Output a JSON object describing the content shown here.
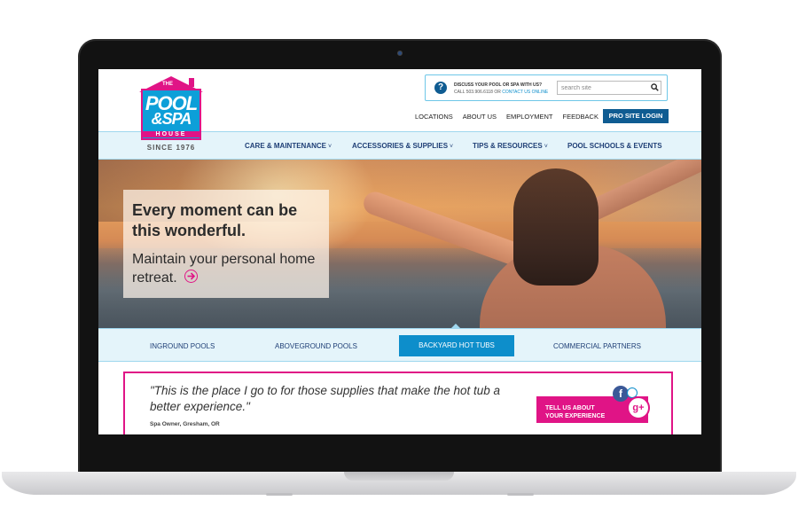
{
  "logo": {
    "the": "THE",
    "pool": "POOL",
    "spa": "&SPA",
    "house": "HOUSE",
    "since": "SINCE 1976"
  },
  "contact": {
    "question": "DISCUSS YOUR POOL OR SPA WITH US?",
    "call_text": "CALL 503.906.6118 OR",
    "contact_link": "CONTACT US ONLINE",
    "search_placeholder": "search site"
  },
  "utility_nav": [
    "LOCATIONS",
    "ABOUT US",
    "EMPLOYMENT",
    "FEEDBACK"
  ],
  "pro_login": "PRO SITE LOGIN",
  "main_nav": [
    {
      "label": "CARE & MAINTENANCE",
      "chevron": "˅"
    },
    {
      "label": "ACCESSORIES & SUPPLIES",
      "chevron": "˅"
    },
    {
      "label": "TIPS & RESOURCES",
      "chevron": "˅"
    },
    {
      "label": "POOL SCHOOLS & EVENTS",
      "chevron": ""
    }
  ],
  "hero": {
    "headline": "Every moment can be this wonderful.",
    "subline": "Maintain your personal home retreat."
  },
  "sub_nav": {
    "items": [
      "INGROUND POOLS",
      "ABOVEGROUND POOLS",
      "BACKYARD HOT TUBS",
      "COMMERCIAL PARTNERS"
    ],
    "active": "BACKYARD HOT TUBS"
  },
  "testimonial": {
    "quote": "\"This is the place I go to for those supplies that make the hot tub a better experience.\"",
    "attribution": "Spa Owner, Gresham, OR",
    "button_line1": "TELL US ABOUT",
    "button_line2": "YOUR EXPERIENCE",
    "facebook_glyph": "f",
    "google_glyph": "g+"
  },
  "colors": {
    "brand_blue": "#0d9fd8",
    "brand_pink": "#e01486",
    "navy": "#0f5c92"
  }
}
